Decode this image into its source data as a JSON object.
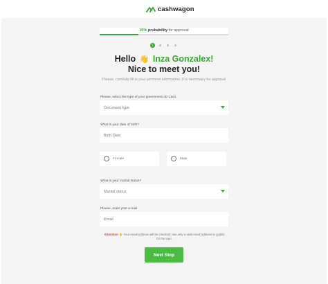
{
  "brand": {
    "name": "cashwagon",
    "accent": "#3ca53a",
    "icon": "hills-logo-icon"
  },
  "progress": {
    "percent": "30%",
    "label_bold": " probability",
    "label_rest": " for approval",
    "fill_fraction": 0.3
  },
  "steps": [
    "1",
    "2",
    "3",
    "4"
  ],
  "active_step": "1",
  "greeting": {
    "hello": "Hello",
    "wave": "👋",
    "name": "Inza Gonzalex!",
    "line2": "Nice to meet you!"
  },
  "subtitle": "Please, carefully fill in your personal information. It is necessary for approval",
  "document": {
    "label": "Please, select the type of your government ID Card",
    "placeholder": "Document type"
  },
  "birth": {
    "label": "What is your date of birth?",
    "placeholder": "Birth Date"
  },
  "gender": {
    "female": "Female",
    "male": "Male"
  },
  "marital": {
    "label": "What is your marital status?",
    "placeholder": "Marital status"
  },
  "email": {
    "label": "Please, enter your e-mail",
    "placeholder": "Email"
  },
  "notice": {
    "attention": "Attention!",
    "icon": "✋",
    "text": " Your email address will be checked! Use only a valid email address to qualify for the loan."
  },
  "next_button": "Next Step",
  "colors": {
    "panel": "#f4f4f4",
    "button": "#4cbb46",
    "attention": "#e13b3b"
  }
}
